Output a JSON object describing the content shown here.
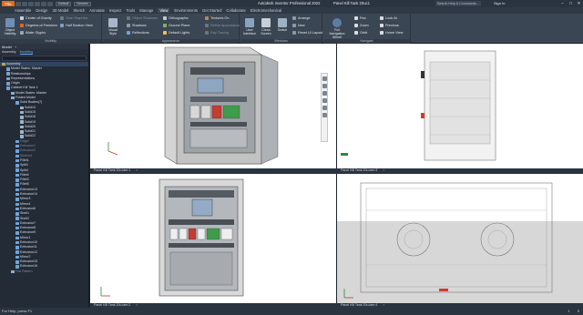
{
  "titlebar": {
    "file": "File",
    "project_combo": "Default",
    "material_combo": "Generic",
    "app_title": "Autodesk Inventor Professional 2022",
    "doc_title": "Panel Kill Tank 20uc1",
    "help_search": "Search Help & Commands...",
    "sign_in": "Sign In",
    "minimize": "–",
    "maximize": "□",
    "close": "✕"
  },
  "tabs": [
    "Assemble",
    "Design",
    "3D Model",
    "Sketch",
    "Annotate",
    "Inspect",
    "Tools",
    "Manage",
    "View",
    "Environments",
    "Get Started",
    "Collaborate",
    "Electromechanical"
  ],
  "active_tab": "View",
  "ribbon": {
    "visibility": {
      "label": "Visibility",
      "object_visibility": "Object Visibility",
      "items": [
        "Center of Gravity",
        "Degrees of Freedom",
        "iMate Glyphs"
      ],
      "right_items": [
        "Glue Graphics",
        "Half Section View"
      ]
    },
    "appearance": {
      "label": "Appearance",
      "visual_style": "Visual Style",
      "col1": [
        "Shadows",
        "Reflections"
      ],
      "col2": [
        "Orthographic",
        "Ground Plane",
        "Default Lights"
      ],
      "col3": [
        "Textures On",
        "Refine Appearance",
        "Ray Tracing"
      ],
      "top_dim": "Object Shadows"
    },
    "windows": {
      "label": "Windows",
      "user_interface": "User Interface",
      "clean_screen": "Clean Screen",
      "switch": "Switch",
      "items": [
        "Arrange",
        "New",
        "Reset UI Layout"
      ]
    },
    "navigate": {
      "label": "Navigate",
      "full_nav_wheel": "Full Navigation Wheel",
      "col1": [
        "Pan",
        "Zoom",
        "Orbit"
      ],
      "col2": [
        "Look At",
        "Previous",
        "Home View"
      ]
    }
  },
  "browser": {
    "title": "Model",
    "tabs": [
      "Assembly",
      "Modeling"
    ],
    "selected_tab": "Modeling",
    "tree": [
      {
        "label": "Assembly",
        "level": 0,
        "hl": true
      },
      {
        "label": "Model States: Master",
        "level": 1
      },
      {
        "label": "Relationships",
        "level": 1
      },
      {
        "label": "Representations",
        "level": 1
      },
      {
        "label": "Origin",
        "level": 1
      },
      {
        "label": "Cabinet Kill Tank 1",
        "level": 1
      },
      {
        "label": "Model States: Master",
        "level": 2
      },
      {
        "label": "Folded Model",
        "level": 2
      },
      {
        "label": "Solid Bodies(7)",
        "level": 3
      },
      {
        "label": "Solid14",
        "level": 4
      },
      {
        "label": "Solid15",
        "level": 4
      },
      {
        "label": "Solid16",
        "level": 4
      },
      {
        "label": "Solid19",
        "level": 4
      },
      {
        "label": "Solid20",
        "level": 4
      },
      {
        "label": "Solid21",
        "level": 4
      },
      {
        "label": "Solid22",
        "level": 4
      },
      {
        "label": "Origin",
        "level": 3,
        "dim": true
      },
      {
        "label": "Extrusion1",
        "level": 3,
        "dim": true
      },
      {
        "label": "Extrusion2",
        "level": 3,
        "dim": true
      },
      {
        "label": "Sketch4",
        "level": 3,
        "dim": true
      },
      {
        "label": "Fillet1",
        "level": 3
      },
      {
        "label": "Split1",
        "level": 3
      },
      {
        "label": "Split4",
        "level": 3
      },
      {
        "label": "Fillet4",
        "level": 3
      },
      {
        "label": "Fillet3",
        "level": 3
      },
      {
        "label": "Fillet5",
        "level": 3
      },
      {
        "label": "Extrusion13",
        "level": 3
      },
      {
        "label": "Extrusion14",
        "level": 3
      },
      {
        "label": "Mirror3",
        "level": 3
      },
      {
        "label": "Mirror4",
        "level": 3
      },
      {
        "label": "Extrusion6",
        "level": 3
      },
      {
        "label": "Shell1",
        "level": 3
      },
      {
        "label": "Shell2",
        "level": 3
      },
      {
        "label": "Extrusion7",
        "level": 3
      },
      {
        "label": "Extrusion8",
        "level": 3
      },
      {
        "label": "Extrusion9",
        "level": 3
      },
      {
        "label": "Mirror1",
        "level": 3
      },
      {
        "label": "Extrusion10",
        "level": 3
      },
      {
        "label": "Extrusion11",
        "level": 3
      },
      {
        "label": "Extrusion12",
        "level": 3
      },
      {
        "label": "Mirror2",
        "level": 3
      },
      {
        "label": "Extrusion15",
        "level": 3
      },
      {
        "label": "Extrusion16",
        "level": 3
      },
      {
        "label": "Flat Pattern",
        "level": 2,
        "dim": true
      }
    ]
  },
  "viewports": {
    "tabs": [
      "Panel Kill Tank 20u.iam:1",
      "Panel Kill Tank 20u.iam:3",
      "Panel Kill Tank 20u.iam:2",
      "Panel Kill Tank 20u.iam:4"
    ],
    "close": "×"
  },
  "statusbar": {
    "text": "For Help, press F1",
    "right": [
      "1",
      "5"
    ]
  },
  "colors": {
    "accent_orange": "#e06a1c",
    "ribbon_bg": "#3b4654",
    "panel_bg": "#232b36",
    "selection_blue": "#6aa8ea"
  }
}
